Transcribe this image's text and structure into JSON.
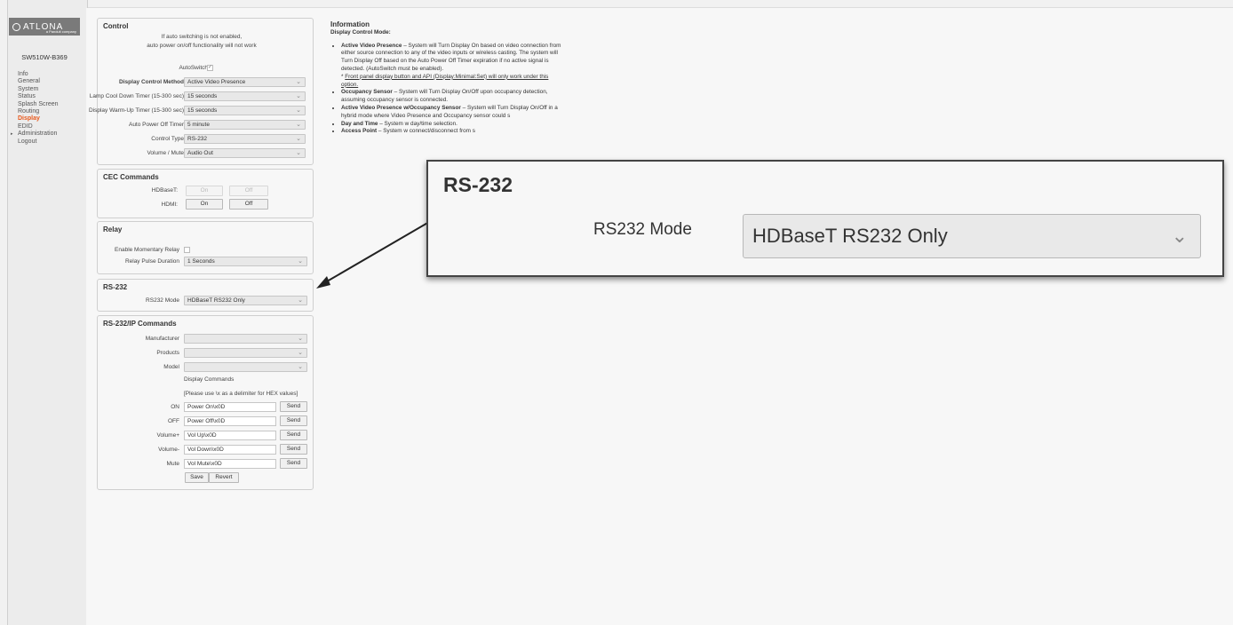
{
  "brand": {
    "name": "ATLONA",
    "sub": "a Panduit company"
  },
  "device_name": "SW510W-B369",
  "nav": [
    "Info",
    "General",
    "System",
    "Status",
    "Splash Screen",
    "Routing",
    "Display",
    "EDID",
    "Administration",
    "Logout"
  ],
  "control": {
    "title": "Control",
    "notice_line1": "If auto switching is not enabled,",
    "notice_line2": "auto power on/off functionality will not work",
    "autoswitch_label": "AutoSwitch",
    "rows": [
      {
        "label": "Display Control Method",
        "value": "Active Video Presence"
      },
      {
        "label": "Lamp Cool Down Timer (15-300 sec)",
        "value": "15 seconds"
      },
      {
        "label": "Display Warm-Up Timer (15-300 sec)",
        "value": "15 seconds"
      },
      {
        "label": "Auto Power Off Timer",
        "value": "5 minute"
      },
      {
        "label": "Control Type",
        "value": "RS-232"
      },
      {
        "label": "Volume / Mute",
        "value": "Audio Out"
      }
    ]
  },
  "cec": {
    "title": "CEC Commands",
    "hdbaset_label": "HDBaseT:",
    "hdmi_label": "HDMI:",
    "on": "On",
    "off": "Off"
  },
  "relay": {
    "title": "Relay",
    "momentary_label": "Enable Momentary Relay",
    "pulse_label": "Relay Pulse Duration",
    "pulse_value": "1 Seconds"
  },
  "rs232": {
    "title": "RS-232",
    "mode_label": "RS232 Mode",
    "mode_value": "HDBaseT RS232 Only"
  },
  "rsip": {
    "title": "RS-232/IP Commands",
    "manufacturer_label": "Manufacturer",
    "products_label": "Products",
    "model_label": "Model",
    "display_commands": "Display Commands",
    "hex_note": "[Please use \\x as a delimiter for HEX values]",
    "commands": [
      {
        "label": "ON",
        "value": "Power On\\x0D"
      },
      {
        "label": "OFF",
        "value": "Power Off\\x0D"
      },
      {
        "label": "Volume+",
        "value": "Vol Up\\x0D"
      },
      {
        "label": "Volume-",
        "value": "Vol Down\\x0D"
      },
      {
        "label": "Mute",
        "value": "Vol Mute\\x0D"
      }
    ],
    "send": "Send",
    "save": "Save",
    "revert": "Revert"
  },
  "info": {
    "title": "Information",
    "subtitle": "Display Control Mode:",
    "items": [
      {
        "head": "Active Video Presence",
        "text": " – System will Turn Display On based on video connection from either source connection to any of the video inputs or wireless casting. The system will Turn Display Off based on the Auto Power Off Timer expiration if no active signal is detected. (AutoSwitch must be enabled).",
        "note": "Front panel display button and API (Display:Minimal:Set) will only work under this option."
      },
      {
        "head": "Occupancy Sensor",
        "text": " – System will Turn Display On/Off upon occupancy detection, assuming occupancy sensor is connected."
      },
      {
        "head": "Active Video Presence w/Occupancy Sensor",
        "text": " – System will Turn Display On/Off in a hybrid mode where Video Presence and Occupancy sensor could s"
      },
      {
        "head": "Day and Time",
        "text": " – System w day/time selection."
      },
      {
        "head": "Access Point",
        "text": " – System w connect/disconnect from s"
      }
    ]
  },
  "zoom": {
    "title": "RS-232",
    "label": "RS232 Mode",
    "value": "HDBaseT RS232 Only"
  }
}
